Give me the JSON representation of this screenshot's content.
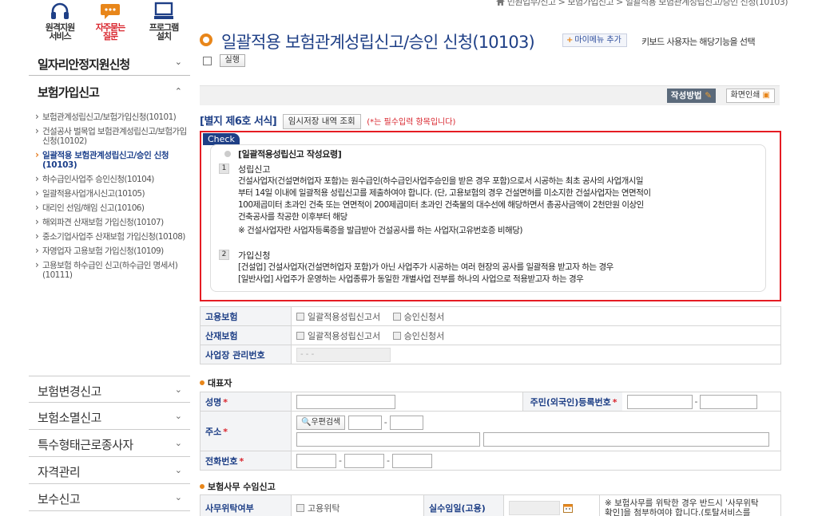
{
  "quick_links": [
    {
      "label1": "원격지원",
      "label2": "서비스",
      "icon": "headset-icon",
      "color": "#1e3f86"
    },
    {
      "label1": "자주묻는",
      "label2": "질문",
      "icon": "speech-bubble-icon",
      "color": "#e8861a"
    },
    {
      "label1": "프로그램",
      "label2": "설치",
      "icon": "monitor-icon",
      "color": "#1e3f86"
    }
  ],
  "sidebar": {
    "top_item": "일자리안정지원신청",
    "section": "보험가입신고",
    "sub_items": [
      "보험관계성립신고/보험가입신청(10101)",
      "건설공사 벌목업 보험관계성립신고/보험가입 신청(10102)",
      "일괄적용 보험관계성립신고/승인 신청(10103)",
      "하수급인사업주 승인신청(10104)",
      "일괄적용사업개시신고(10105)",
      "대리인 선임/해임 신고(10106)",
      "해외파견 산재보험 가입신청(10107)",
      "중소기업사업주 산재보험 가입신청(10108)",
      "자영업자 고용보험 가입신청(10109)",
      "고용보험 하수급인 신고(하수급인 명세서)(10111)"
    ],
    "active_index": 2,
    "bottom_items": [
      "보험변경신고",
      "보험소멸신고",
      "특수형태근로종사자",
      "자격관리",
      "보수신고"
    ]
  },
  "breadcrumb": "민원업무/신고  >  보험가입신고  >  일괄적용 보험관계성립신고/승인 신청(10103)",
  "page": {
    "title": "일괄적용 보험관계성립신고/승인 신청(10103)",
    "mymenu_label": "마이메뉴 추가",
    "keyboard_note": "키보드 사용자는 해당기능을 선택",
    "exec_label": "실행"
  },
  "toolbar": {
    "howto_label": "작성방법",
    "print_label": "화면인쇄"
  },
  "form_head": {
    "title": "[별지 제6호 서식]",
    "temp_button": "임시저장 내역 조회",
    "required_note": "(*는 필수입력 항목입니다)"
  },
  "check": {
    "tag": "Check",
    "title": "[일괄적용성립신고 작성요령]",
    "sections": [
      {
        "num": "1",
        "heading": "성립신고",
        "lines": [
          "건설사업자(건설면허업자 포함)는 원수급인(하수급인사업주승인을 받은 경우 포함)으로서 시공하는 최초 공사의 사업개시일",
          "부터 14일 이내에 일괄적용 성립신고를 제출하여야 합니다. (단, 고용보험의 경우 건설면허를 미소지한 건설사업자는 연면적이",
          "100제곱미터 초과인 건축 또는 연면적이 200제곱미터 초과인 건축물의 대수선에 해당하면서 총공사금액이 2천만원 이상인",
          "건축공사를 착공한 이후부터 해당",
          "※ 건설사업자란 사업자등록증을 발급받아 건설공사를 하는 사업자(고유번호증 비해당)"
        ]
      },
      {
        "num": "2",
        "heading": "가입신청",
        "lines": [
          "[건설업] 건설사업자(건설면허업자 포함)가 아닌 사업주가 시공하는 여러 현장의 공사를 일괄적용 받고자 하는 경우",
          "[일반사업] 사업주가 운영하는 사업종류가 동일한 개별사업 전부를 하나의 사업으로 적용받고자 하는 경우"
        ]
      }
    ]
  },
  "insurance_table": {
    "rows": [
      {
        "label": "고용보험",
        "opt1": "일괄적용성립신고서",
        "opt2": "승인신청서"
      },
      {
        "label": "산재보험",
        "opt1": "일괄적용성립신고서",
        "opt2": "승인신청서"
      }
    ],
    "mgmt_label": "사업장 관리번호",
    "mgmt_value": "-   -   -"
  },
  "representative": {
    "section": "대표자",
    "name_label": "성명",
    "rrn_label": "주민(외국인)등록번호",
    "address_label": "주소",
    "postal_button": "우편검색",
    "phone_label": "전화번호"
  },
  "agency": {
    "section": "보험사무 수임신고",
    "entrust_label": "사무위탁여부",
    "entrust_option": "고용위탁",
    "date_label": "실수임일(고용)",
    "note": "※ 보험사무를 위탁한 경우 반드시 '사무위탁",
    "note2": "확인]을 첨부하여야 합니다.(토탈서비스를"
  }
}
